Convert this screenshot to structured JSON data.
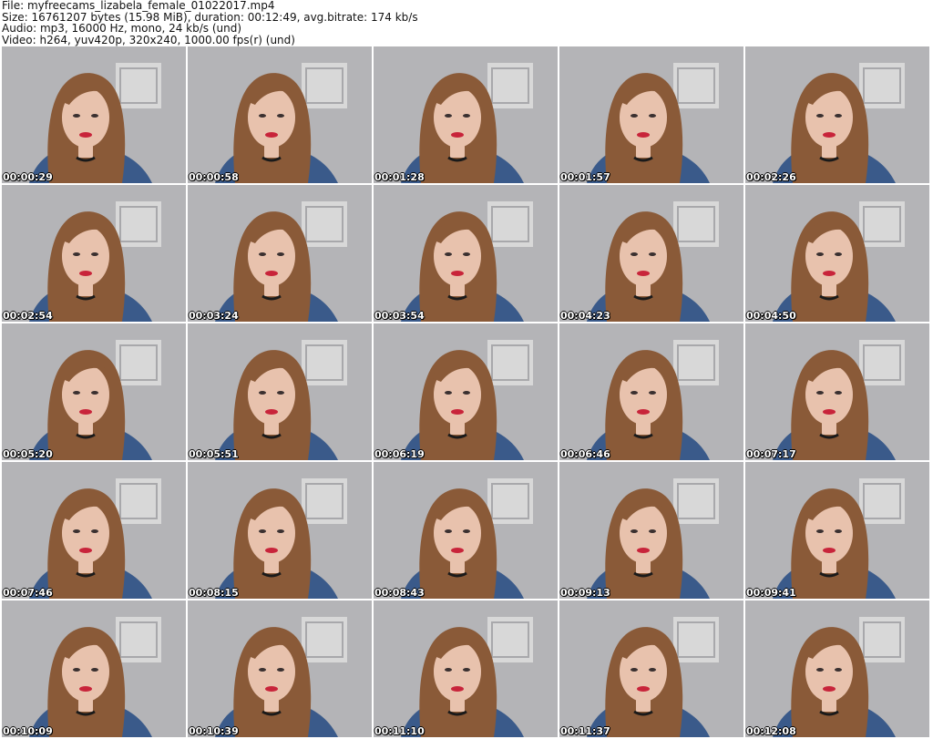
{
  "header": {
    "file_line": "File: myfreecams_lizabela_female_01022017.mp4",
    "size_line": "Size: 16761207 bytes (15.98 MiB), duration: 00:12:49, avg.bitrate: 174 kb/s",
    "audio_line": "Audio: mp3, 16000 Hz, mono, 24 kb/s (und)",
    "video_line": "Video: h264, yuv420p, 320x240, 1000.00 fps(r) (und)"
  },
  "thumbnails": [
    {
      "timestamp": "00:00:29"
    },
    {
      "timestamp": "00:00:58"
    },
    {
      "timestamp": "00:01:28"
    },
    {
      "timestamp": "00:01:57"
    },
    {
      "timestamp": "00:02:26"
    },
    {
      "timestamp": "00:02:54"
    },
    {
      "timestamp": "00:03:24"
    },
    {
      "timestamp": "00:03:54"
    },
    {
      "timestamp": "00:04:23"
    },
    {
      "timestamp": "00:04:50"
    },
    {
      "timestamp": "00:05:20"
    },
    {
      "timestamp": "00:05:51"
    },
    {
      "timestamp": "00:06:19"
    },
    {
      "timestamp": "00:06:46"
    },
    {
      "timestamp": "00:07:17"
    },
    {
      "timestamp": "00:07:46"
    },
    {
      "timestamp": "00:08:15"
    },
    {
      "timestamp": "00:08:43"
    },
    {
      "timestamp": "00:09:13"
    },
    {
      "timestamp": "00:09:41"
    },
    {
      "timestamp": "00:10:09"
    },
    {
      "timestamp": "00:10:39"
    },
    {
      "timestamp": "00:11:10"
    },
    {
      "timestamp": "00:11:37"
    },
    {
      "timestamp": "00:12:08"
    }
  ],
  "colors": {
    "wall": "#b4b4b7",
    "door": "#dcdcdc",
    "hair": "#8a5a38",
    "skin": "#e8c2ad",
    "lips": "#c8243a",
    "shirt": "#3a5a8a",
    "choker": "#1a1a1a"
  }
}
